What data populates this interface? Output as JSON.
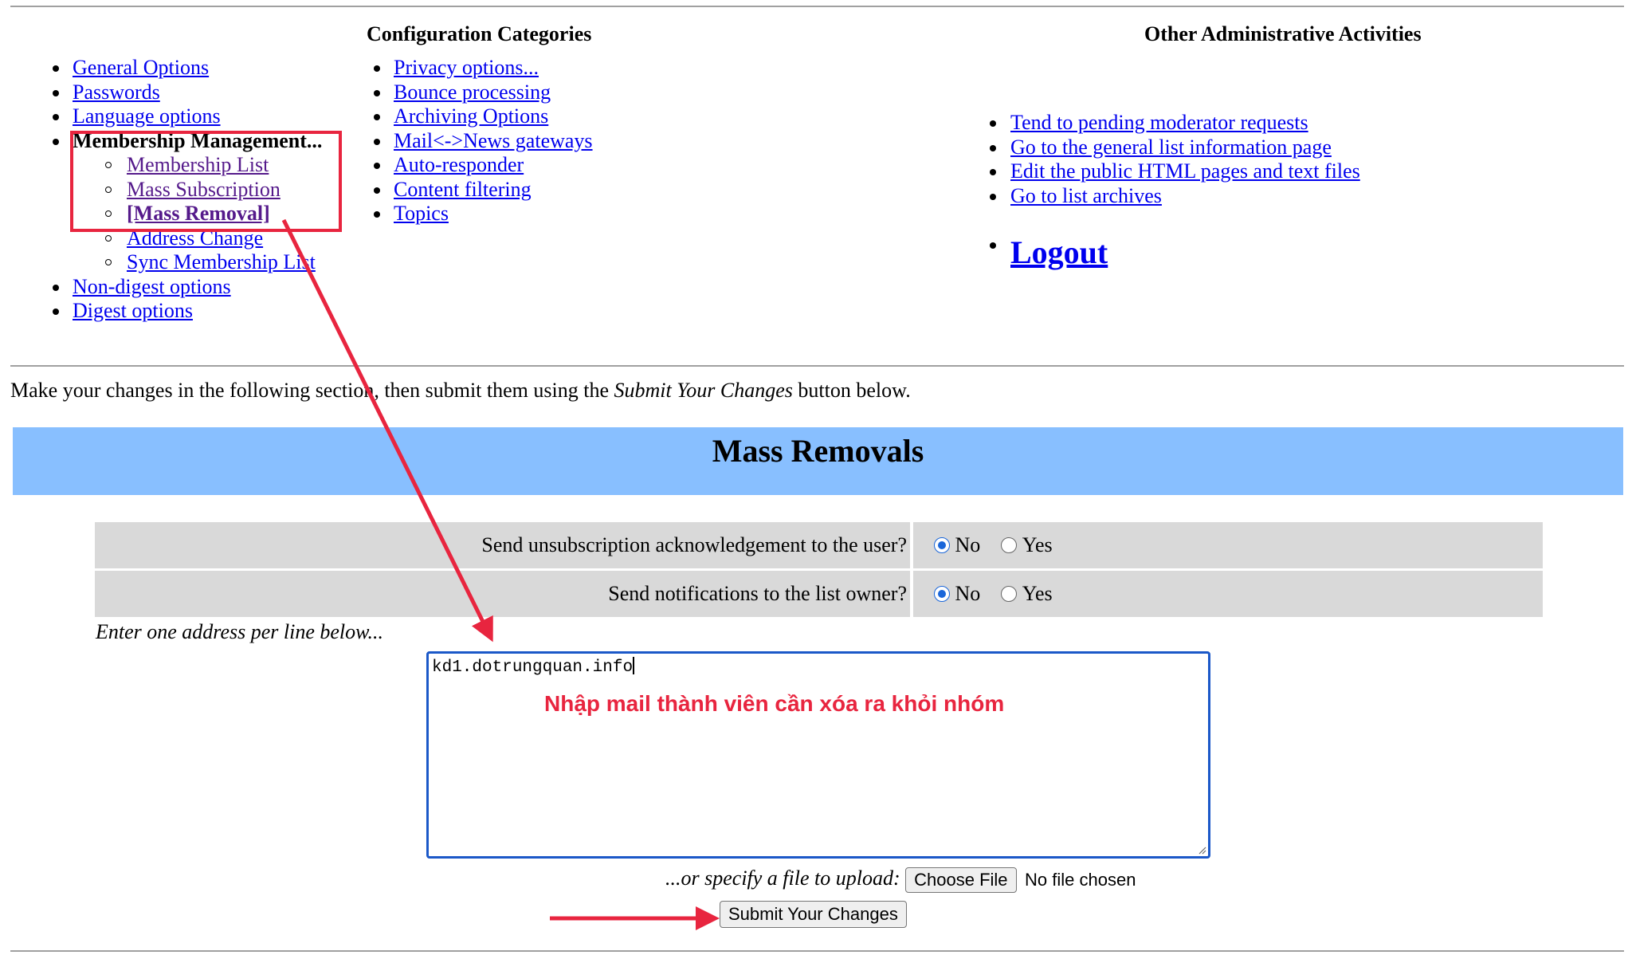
{
  "header": {
    "config_heading": "Configuration Categories",
    "other_heading": "Other Administrative Activities"
  },
  "nav_left": [
    "General Options",
    "Passwords",
    "Language options",
    "Membership Management...",
    "Non-digest options",
    "Digest options"
  ],
  "membership_sub": [
    "Membership List",
    "Mass Subscription",
    "[Mass Removal]",
    "Address Change",
    "Sync Membership List"
  ],
  "nav_middle": [
    "Privacy options...",
    "Bounce processing",
    "Archiving Options",
    "Mail<->News gateways",
    "Auto-responder",
    "Content filtering",
    "Topics"
  ],
  "nav_right": [
    "Tend to pending moderator requests",
    "Go to the general list information page",
    "Edit the public HTML pages and text files",
    "Go to list archives"
  ],
  "logout": "Logout",
  "instructions": {
    "before": "Make your changes in the following section, then submit them using the ",
    "emphasis": "Submit Your Changes",
    "after": " button below."
  },
  "section_title": "Mass Removals",
  "options": [
    {
      "question": "Send unsubscription acknowledgement to the user?",
      "no": "No",
      "yes": "Yes",
      "selected": "No"
    },
    {
      "question": "Send notifications to the list owner?",
      "no": "No",
      "yes": "Yes",
      "selected": "No"
    }
  ],
  "address_hint": "Enter one address per line below...",
  "textarea_value": "kd1.dotrungquan.info",
  "annotation_text": "Nhập mail thành viên cần xóa ra khỏi nhóm",
  "upload": {
    "label": "...or specify a file to upload:",
    "button": "Choose File",
    "status": "No file chosen"
  },
  "submit_label": "Submit Your Changes",
  "colors": {
    "link": "#0000ee",
    "visited": "#551a8b",
    "banner": "#88bfff",
    "row_bg": "#d9d9d9",
    "annotation": "#e8253f",
    "focus": "#1b58c8"
  }
}
